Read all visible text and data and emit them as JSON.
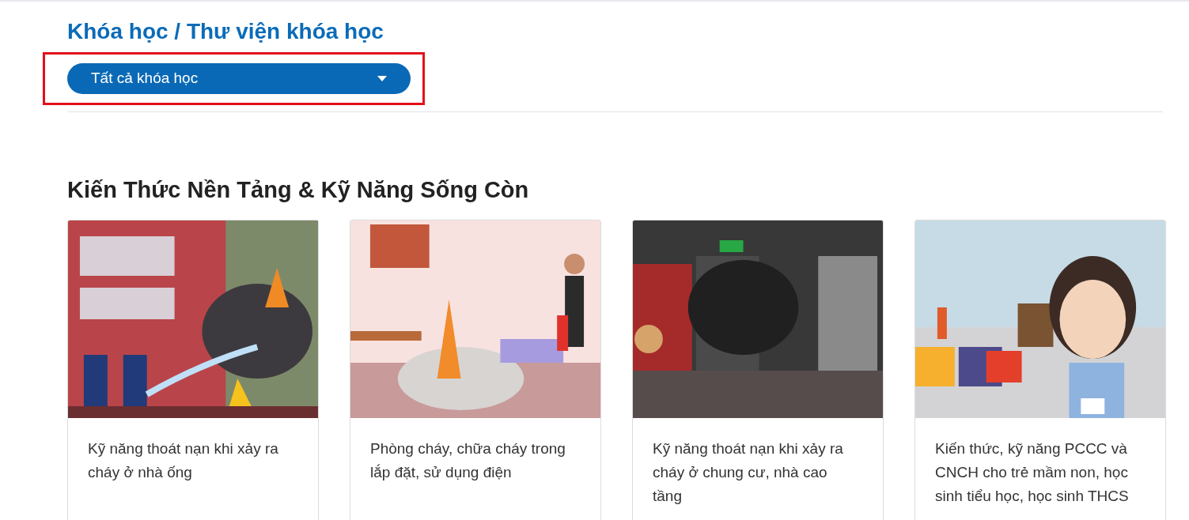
{
  "breadcrumb": "Khóa học / Thư viện khóa học",
  "filter": {
    "value": "Tất cả khóa học",
    "highlighted": true
  },
  "section": {
    "title": "Kiến Thức Nền Tảng & Kỹ Năng Sống Còn",
    "courses": [
      {
        "title": "Kỹ năng thoát nạn khi xảy ra cháy ở nhà ống"
      },
      {
        "title": "Phòng cháy, chữa cháy trong lắp đặt, sử dụng điện"
      },
      {
        "title": "Kỹ năng thoát nạn khi xảy ra cháy ở chung cư, nhà cao tầng"
      },
      {
        "title": "Kiến thức, kỹ năng PCCC và CNCH cho trẻ mầm non, học sinh tiểu học, học sinh THCS"
      }
    ]
  }
}
